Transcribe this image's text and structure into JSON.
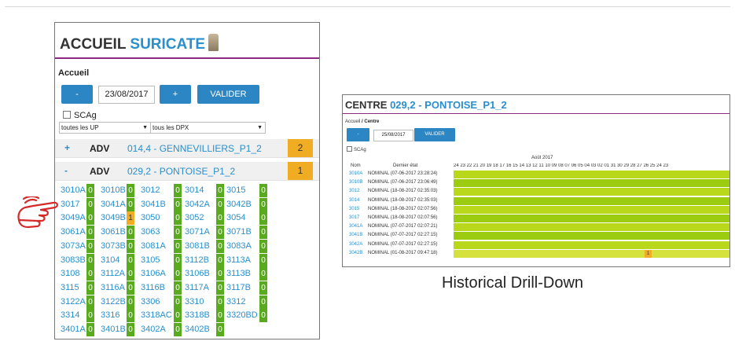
{
  "left_panel": {
    "title_part1": "ACCUEIL",
    "title_part2": "SURICATE",
    "breadcrumb": "Accueil",
    "minus_label": "-",
    "date_value": "23/08/2017",
    "plus_label": "+",
    "valider_label": "VALIDER",
    "checkbox_label": "SCAg",
    "select_up": "toutes les UP",
    "select_dpx": "tous les DPX",
    "rows": [
      {
        "sign": "+",
        "adv": "ADV",
        "site": "014,4 - GENNEVILLIERS_P1_2",
        "count": "2"
      },
      {
        "sign": "-",
        "adv": "ADV",
        "site": "029,2 - PONTOISE_P1_2",
        "count": "1"
      }
    ],
    "grid": [
      [
        {
          "code": "3010A",
          "num": "0"
        },
        {
          "code": "3010B",
          "num": "0"
        },
        {
          "code": "3012",
          "num": "0"
        },
        {
          "code": "3014",
          "num": "0"
        },
        {
          "code": "3015",
          "num": "0"
        }
      ],
      [
        {
          "code": "3017",
          "num": "0"
        },
        {
          "code": "3041A",
          "num": "0"
        },
        {
          "code": "3041B",
          "num": "0"
        },
        {
          "code": "3042A",
          "num": "0"
        },
        {
          "code": "3042B",
          "num": "0"
        }
      ],
      [
        {
          "code": "3049A",
          "num": "0"
        },
        {
          "code": "3049B",
          "num": "1"
        },
        {
          "code": "3050",
          "num": "0"
        },
        {
          "code": "3052",
          "num": "0"
        },
        {
          "code": "3054",
          "num": "0"
        }
      ],
      [
        {
          "code": "3061A",
          "num": "0"
        },
        {
          "code": "3061B",
          "num": "0"
        },
        {
          "code": "3063",
          "num": "0"
        },
        {
          "code": "3071A",
          "num": "0"
        },
        {
          "code": "3071B",
          "num": "0"
        }
      ],
      [
        {
          "code": "3073A",
          "num": "0"
        },
        {
          "code": "3073B",
          "num": "0"
        },
        {
          "code": "3081A",
          "num": "0"
        },
        {
          "code": "3081B",
          "num": "0"
        },
        {
          "code": "3083A",
          "num": "0"
        }
      ],
      [
        {
          "code": "3083B",
          "num": "0"
        },
        {
          "code": "3104",
          "num": "0"
        },
        {
          "code": "3105",
          "num": "0"
        },
        {
          "code": "3112B",
          "num": "0"
        },
        {
          "code": "3113A",
          "num": "0"
        }
      ],
      [
        {
          "code": "3108",
          "num": "0"
        },
        {
          "code": "3112A",
          "num": "0"
        },
        {
          "code": "3106A",
          "num": "0"
        },
        {
          "code": "3106B",
          "num": "0"
        },
        {
          "code": "3113B",
          "num": "0"
        }
      ],
      [
        {
          "code": "3115",
          "num": "0"
        },
        {
          "code": "3116A",
          "num": "0"
        },
        {
          "code": "3116B",
          "num": "0"
        },
        {
          "code": "3117A",
          "num": "0"
        },
        {
          "code": "3117B",
          "num": "0"
        }
      ],
      [
        {
          "code": "3122A",
          "num": "0"
        },
        {
          "code": "3122B",
          "num": "0"
        },
        {
          "code": "3306",
          "num": "0"
        },
        {
          "code": "3310",
          "num": "0"
        },
        {
          "code": "3312",
          "num": "0"
        }
      ],
      [
        {
          "code": "3314",
          "num": "0"
        },
        {
          "code": "3316",
          "num": "0"
        },
        {
          "code": "3318AC",
          "num": "0"
        },
        {
          "code": "3318B",
          "num": "0"
        },
        {
          "code": "3320BD",
          "num": "0"
        }
      ],
      [
        {
          "code": "3401A",
          "num": "0"
        },
        {
          "code": "3401B",
          "num": "0"
        },
        {
          "code": "3402A",
          "num": "0"
        },
        {
          "code": "3402B",
          "num": "0"
        }
      ]
    ]
  },
  "right_panel": {
    "title_part1": "CENTRE",
    "title_part2": "029,2 - PONTOISE_P1_2",
    "breadcrumb_home": "Accueil",
    "breadcrumb_sep": " / ",
    "breadcrumb_current": "Centre",
    "minus_label": "-",
    "date_value": "25/08/2017",
    "valider_label": "VALIDER",
    "checkbox_label": "SCAg",
    "month_label": "Août 2017",
    "col_nom": "Nom",
    "col_etat": "Dernier état",
    "days": "24 23 22 21 20 19 18 17 16 15 14 13 12 11 10 09 08 07 06 05 04 03 02 01 31 30 29 28 27 26 25 24 23",
    "rows": [
      {
        "code": "3010A",
        "etat": "NOMINAL (07-06-2017 23:28:24)",
        "shade": "a"
      },
      {
        "code": "3010B",
        "etat": "NOMINAL (07-06-2017 23:06:49)",
        "shade": "b"
      },
      {
        "code": "3012",
        "etat": "NOMINAL (18-08-2017 02:35:03)",
        "shade": "a"
      },
      {
        "code": "3014",
        "etat": "NOMINAL (18-08-2017 02:35:03)",
        "shade": "b"
      },
      {
        "code": "3015",
        "etat": "NOMINAL (18-08-2017 02:07:56)",
        "shade": "a"
      },
      {
        "code": "3017",
        "etat": "NOMINAL (18-08-2017 02:07:56)",
        "shade": "b"
      },
      {
        "code": "3041A",
        "etat": "NOMINAL (07-07-2017 02:07:21)",
        "shade": "a"
      },
      {
        "code": "3041B",
        "etat": "NOMINAL (07-07-2017 02:27:15)",
        "shade": "b"
      },
      {
        "code": "3042A",
        "etat": "NOMINAL (07-07-2017 02:27:15)",
        "shade": "a"
      },
      {
        "code": "3042B",
        "etat": "NOMINAL (01-08-2017 09:47:18)",
        "shade": "c",
        "warn": "1"
      }
    ]
  },
  "caption": "Historical Drill-Down",
  "colors": {
    "accent_blue": "#2a8fcc",
    "button_blue": "#2b86c3",
    "ok_green": "#5aaa1f",
    "warn_orange": "#f0ad23",
    "rule_purple": "#8e2b7c"
  }
}
